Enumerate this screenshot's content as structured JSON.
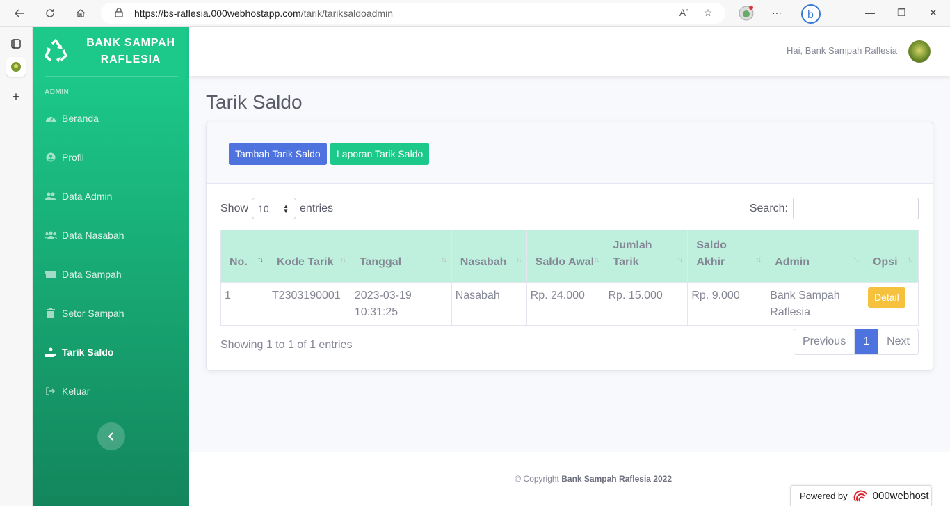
{
  "browser": {
    "url_host": "https://bs-raflesia.000webhostapp.com",
    "url_path": "/tarik/tariksaldoadmin"
  },
  "sidebar": {
    "brand": "BANK SAMPAH RAFLESIA",
    "heading": "ADMIN",
    "items": [
      {
        "label": "Beranda",
        "icon": "tachometer-icon"
      },
      {
        "label": "Profil",
        "icon": "user-circle-icon"
      },
      {
        "label": "Data Admin",
        "icon": "users-icon"
      },
      {
        "label": "Data Nasabah",
        "icon": "users-group-icon"
      },
      {
        "label": "Data Sampah",
        "icon": "dumpster-icon"
      },
      {
        "label": "Setor Sampah",
        "icon": "trash-icon"
      },
      {
        "label": "Tarik Saldo",
        "icon": "hand-holding-icon"
      },
      {
        "label": "Keluar",
        "icon": "sign-out-icon"
      }
    ],
    "active": "Tarik Saldo"
  },
  "topbar": {
    "greeting": "Hai, Bank Sampah Raflesia"
  },
  "page": {
    "title": "Tarik Saldo",
    "buttons": {
      "add": "Tambah Tarik Saldo",
      "report": "Laporan Tarik Saldo"
    },
    "length": {
      "show": "Show",
      "value": "10",
      "entries": "entries"
    },
    "search_label": "Search:",
    "table": {
      "headers": [
        "No.",
        "Kode Tarik",
        "Tanggal",
        "Nasabah",
        "Saldo Awal",
        "Jumlah Tarik",
        "Saldo Akhir",
        "Admin",
        "Opsi"
      ],
      "rows": [
        {
          "no": "1",
          "kode": "T2303190001",
          "tanggal": "2023-03-19 10:31:25",
          "nasabah": "Nasabah",
          "saldo_awal": "Rp. 24.000",
          "jumlah": "Rp. 15.000",
          "saldo_akhir": "Rp. 9.000",
          "admin": "Bank Sampah Raflesia",
          "opsi": "Detail"
        }
      ]
    },
    "info": "Showing 1 to 1 of 1 entries",
    "pagination": {
      "prev": "Previous",
      "current": "1",
      "next": "Next"
    }
  },
  "footer": {
    "copy_prefix": "© Copyright",
    "copy_name": "Bank Sampah Raflesia 2022"
  },
  "powered": {
    "label": "Powered by",
    "brand": "000webhost"
  },
  "colors": {
    "sidebar_top": "#1cc88a",
    "sidebar_bottom": "#13855c",
    "primary": "#4e73df",
    "success": "#1cc88a",
    "warning": "#f6c23e",
    "table_header": "#bff0dd"
  }
}
